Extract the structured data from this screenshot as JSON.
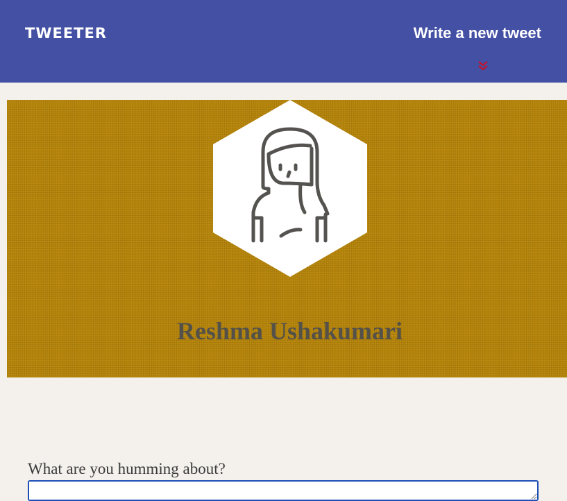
{
  "nav": {
    "brand": "TWEETER",
    "compose_link": "Write a new tweet",
    "compose_icon": "double-chevron-down-icon",
    "compose_icon_color": "#c0152f"
  },
  "profile": {
    "avatar_icon": "woman-avatar-icon",
    "name": "Reshma Ushakumari",
    "banner_color": "#b8860b"
  },
  "compose": {
    "label": "What are you humming about?",
    "input_value": "",
    "input_placeholder": ""
  },
  "colors": {
    "nav_bg": "#4350a4",
    "page_bg": "#f4f1ed",
    "input_border": "#1d4fb5"
  }
}
